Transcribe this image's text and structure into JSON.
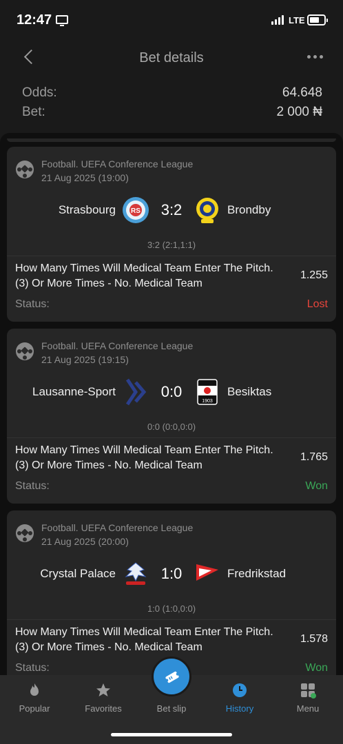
{
  "status_bar": {
    "time": "12:47",
    "network": "LTE"
  },
  "header": {
    "title": "Bet details",
    "back_icon": "chevron-left-icon",
    "more_icon": "more-horizontal-icon"
  },
  "summary": {
    "odds_label": "Odds:",
    "odds_value": "64.648",
    "bet_label": "Bet:",
    "bet_value": "2 000 ₦"
  },
  "bets": [
    {
      "league": "Football. UEFA Conference League",
      "date": "21 Aug 2025 (19:00)",
      "home": "Strasbourg",
      "away": "Brondby",
      "score": "3:2",
      "detail_score": "3:2 (2:1,1:1)",
      "market": "How Many Times Will Medical Team Enter The Pitch. (3) Or More Times - No. Medical Team",
      "odds": "1.255",
      "status_label": "Status:",
      "status": "Lost",
      "status_color": "#e8453c"
    },
    {
      "league": "Football. UEFA Conference League",
      "date": "21 Aug 2025 (19:15)",
      "home": "Lausanne-Sport",
      "away": "Besiktas",
      "score": "0:0",
      "detail_score": "0:0 (0:0,0:0)",
      "market": "How Many Times Will Medical Team Enter The Pitch. (3) Or More Times - No. Medical Team",
      "odds": "1.765",
      "status_label": "Status:",
      "status": "Won",
      "status_color": "#3aa757"
    },
    {
      "league": "Football. UEFA Conference League",
      "date": "21 Aug 2025 (20:00)",
      "home": "Crystal Palace",
      "away": "Fredrikstad",
      "score": "1:0",
      "detail_score": "1:0 (1:0,0:0)",
      "market": "How Many Times Will Medical Team Enter The Pitch. (3) Or More Times - No. Medical Team",
      "odds": "1.578",
      "status_label": "Status:",
      "status": "Won",
      "status_color": "#3aa757"
    }
  ],
  "tabs": [
    {
      "label": "Popular",
      "icon": "flame-icon",
      "active": false
    },
    {
      "label": "Favorites",
      "icon": "star-icon",
      "active": false
    },
    {
      "label": "Bet slip",
      "icon": "ticket-icon",
      "active": false
    },
    {
      "label": "History",
      "icon": "clock-icon",
      "active": true
    },
    {
      "label": "Menu",
      "icon": "grid-icon",
      "active": false
    }
  ],
  "colors": {
    "accent": "#2f8fd8",
    "won": "#3aa757",
    "lost": "#e8453c"
  }
}
